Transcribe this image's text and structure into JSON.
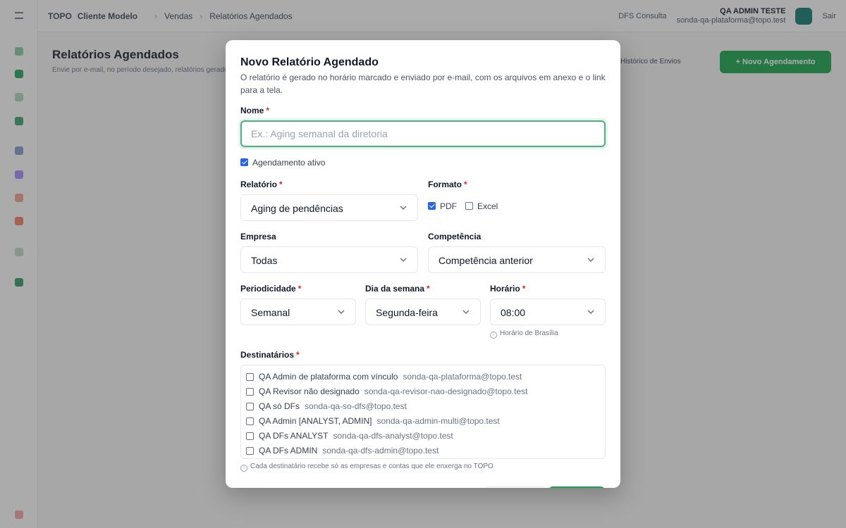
{
  "background": {
    "brand": "TOPO",
    "client": "Cliente Modelo",
    "breadcrumb_vendas": "Vendas",
    "breadcrumb_page": "Relatórios Agendados",
    "context_label": "DFS Consulta",
    "user_name": "QA ADMIN TESTE",
    "user_email": "sonda-qa-plataforma@topo.test",
    "logout_label": "Sair",
    "page_title": "Relatórios Agendados",
    "page_subtitle": "Envie por e-mail, no período desejado, relatórios gerados automaticamente",
    "history_button": "Histórico de Envios",
    "new_button": "+ Novo Agendamento"
  },
  "modal": {
    "title": "Novo Relatório Agendado",
    "description": "O relatório é gerado no horário marcado e enviado por e-mail, com os arquivos em anexo e o link para a tela.",
    "name": {
      "label": "Nome",
      "placeholder": "Ex.: Aging semanal da diretoria",
      "value": ""
    },
    "active": {
      "label": "Agendamento ativo",
      "checked": true
    },
    "report": {
      "label": "Relatório",
      "value": "Aging de pendências"
    },
    "format": {
      "label": "Formato",
      "options": [
        {
          "label": "PDF",
          "checked": true
        },
        {
          "label": "Excel",
          "checked": false
        }
      ]
    },
    "company": {
      "label": "Empresa",
      "value": "Todas"
    },
    "period": {
      "label": "Competência",
      "value": "Competência anterior"
    },
    "frequency": {
      "label": "Periodicidade",
      "value": "Semanal"
    },
    "weekday": {
      "label": "Dia da semana",
      "value": "Segunda-feira"
    },
    "time": {
      "label": "Horário",
      "value": "08:00",
      "hint": "Horário de Brasília"
    },
    "recipients": {
      "label": "Destinatários",
      "items": [
        {
          "name": "QA Admin de plataforma com vínculo",
          "email": "sonda-qa-plataforma@topo.test",
          "checked": false
        },
        {
          "name": "QA Revisor não designado",
          "email": "sonda-qa-revisor-nao-designado@topo.test",
          "checked": false
        },
        {
          "name": "QA só DFs",
          "email": "sonda-qa-so-dfs@topo.test",
          "checked": false
        },
        {
          "name": "QA Admin [ANALYST, ADMIN]",
          "email": "sonda-qa-admin-multi@topo.test",
          "checked": false
        },
        {
          "name": "QA DFs ANALYST",
          "email": "sonda-qa-dfs-analyst@topo.test",
          "checked": false
        },
        {
          "name": "QA DFs ADMIN",
          "email": "sonda-qa-dfs-admin@topo.test",
          "checked": false
        }
      ],
      "hint": "Cada destinatário recebe só as empresas e contas que ele enxerga no TOPO"
    }
  },
  "colors": {
    "accent": "#16a34a",
    "focus_ring": "#4caf80",
    "checkbox_on": "#2563eb",
    "required": "#dc2626"
  }
}
